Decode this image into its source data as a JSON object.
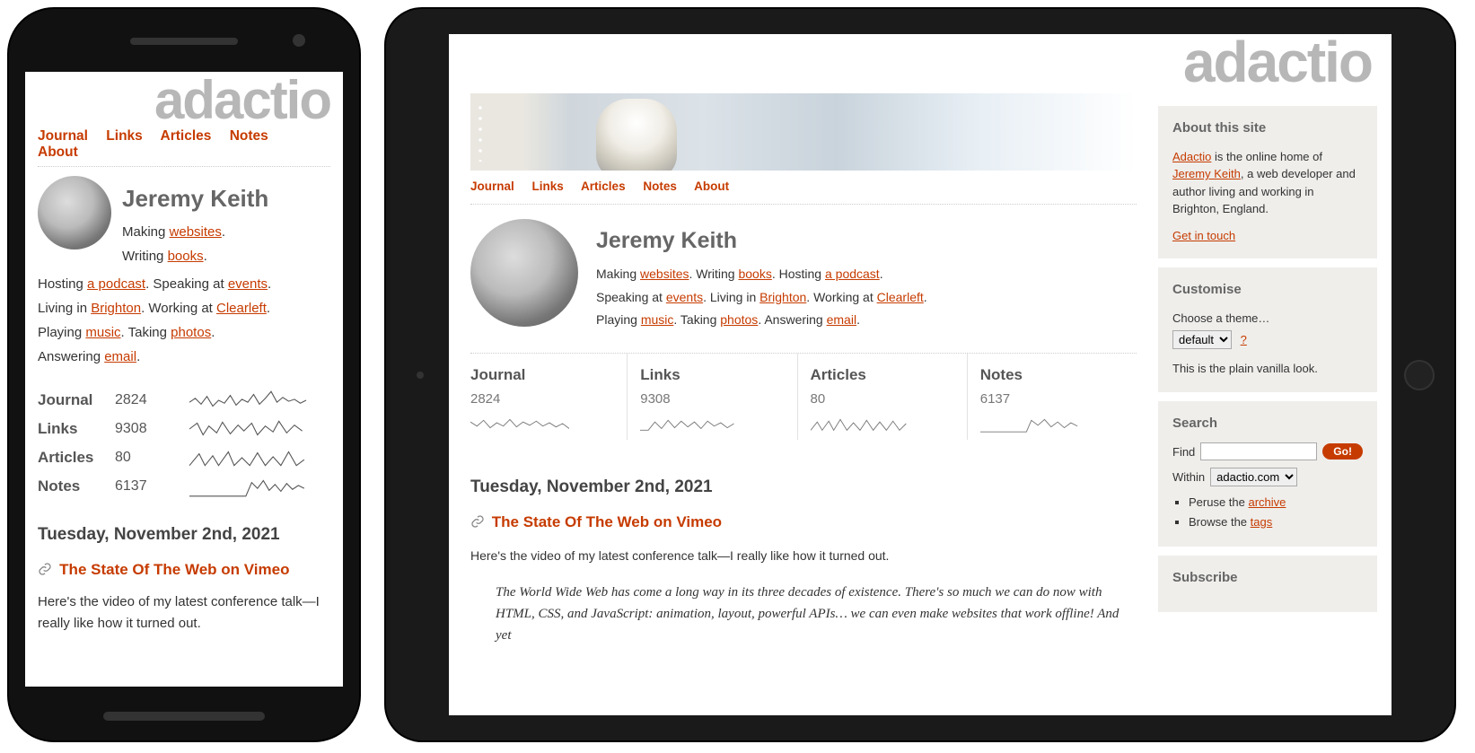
{
  "site": {
    "logo": "adactio",
    "nav": [
      "Journal",
      "Links",
      "Articles",
      "Notes",
      "About"
    ]
  },
  "author": {
    "name": "Jeremy Keith",
    "bio": {
      "making": "Making ",
      "making_link": "websites",
      "writing": "Writing ",
      "writing_link": "books",
      "hosting": "Hosting ",
      "hosting_link": "a podcast",
      "speaking": "Speaking at ",
      "speaking_link": "events",
      "living": "Living in ",
      "living_link": "Brighton",
      "working": "Working at ",
      "working_link": "Clearleft",
      "playing": "Playing ",
      "playing_link": "music",
      "taking": "Taking ",
      "taking_link": "photos",
      "answering": "Answering ",
      "answering_link": "email"
    }
  },
  "stats": [
    {
      "label": "Journal",
      "value": "2824"
    },
    {
      "label": "Links",
      "value": "9308"
    },
    {
      "label": "Articles",
      "value": "80"
    },
    {
      "label": "Notes",
      "value": "6137"
    }
  ],
  "post": {
    "date": "Tuesday, November 2nd, 2021",
    "title": "The State Of The Web on Vimeo",
    "excerpt": "Here's the video of my latest conference talk—I really like how it turned out.",
    "quote": "The World Wide Web has come a long way in its three decades of existence. There's so much we can do now with HTML, CSS, and JavaScript: animation, layout, powerful APIs… we can even make websites that work offline! And yet"
  },
  "sidebar": {
    "about": {
      "heading": "About this site",
      "adactio": "Adactio",
      "mid1": " is the online home of ",
      "jeremy": "Jeremy Keith",
      "mid2": ", a web developer and author living and working in Brighton, England.",
      "contact": "Get in touch"
    },
    "customise": {
      "heading": "Customise",
      "choose": "Choose a theme…",
      "selected": "default",
      "help": "?",
      "desc": "This is the plain vanilla look."
    },
    "search": {
      "heading": "Search",
      "find": "Find",
      "go": "Go!",
      "within": "Within",
      "within_selected": "adactio.com",
      "peruse": "Peruse the ",
      "archive": "archive",
      "browse": "Browse the ",
      "tags": "tags"
    },
    "subscribe": {
      "heading": "Subscribe"
    }
  }
}
